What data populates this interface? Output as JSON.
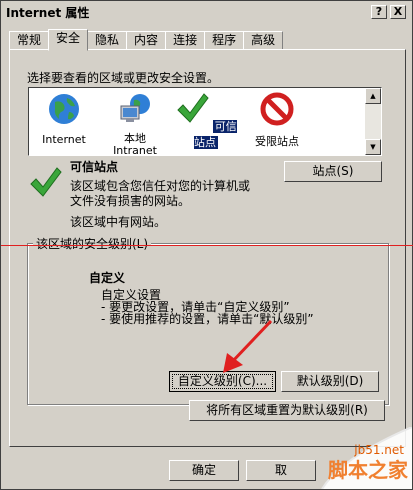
{
  "window": {
    "title": "Internet 属性",
    "help_btn": "?",
    "close_btn": "X"
  },
  "tabs": [
    {
      "label": "常规"
    },
    {
      "label": "安全"
    },
    {
      "label": "隐私"
    },
    {
      "label": "内容"
    },
    {
      "label": "连接"
    },
    {
      "label": "程序"
    },
    {
      "label": "高级"
    }
  ],
  "zones": {
    "prompt": "选择要查看的区域或更改安全设置。",
    "items": [
      {
        "label": "Internet",
        "icon": "globe-icon"
      },
      {
        "label": "本地\nIntranet",
        "icon": "computer-globe-icon"
      },
      {
        "label": "可信站点",
        "icon": "checkmark-icon",
        "selected": true
      },
      {
        "label": "受限站点",
        "icon": "prohibited-icon"
      }
    ]
  },
  "selected_zone": {
    "name": "可信站点",
    "desc_line1": "该区域包含您信任对您的计算机或",
    "desc_line2": "文件没有损害的网站。",
    "status": "该区域中有网站。",
    "sites_button": "站点(S)"
  },
  "security_level": {
    "group_title": "该区域的安全级别(L)",
    "heading": "自定义",
    "line1": "自定义设置",
    "line2": "- 要更改设置，请单击“自定义级别”",
    "line3": "- 要使用推荐的设置，请单击“默认级别”",
    "custom_button": "自定义级别(C)...",
    "default_button": "默认级别(D)",
    "reset_button": "将所有区域重置为默认级别(R)"
  },
  "footer": {
    "ok_button": "确定",
    "cancel_button": "取"
  },
  "watermark": {
    "line1": "jb51.net",
    "line2": "脚本之家"
  },
  "colors": {
    "dialog_bg": "#d4d0c8",
    "selection": "#0a246a",
    "arrow": "#e02020"
  }
}
